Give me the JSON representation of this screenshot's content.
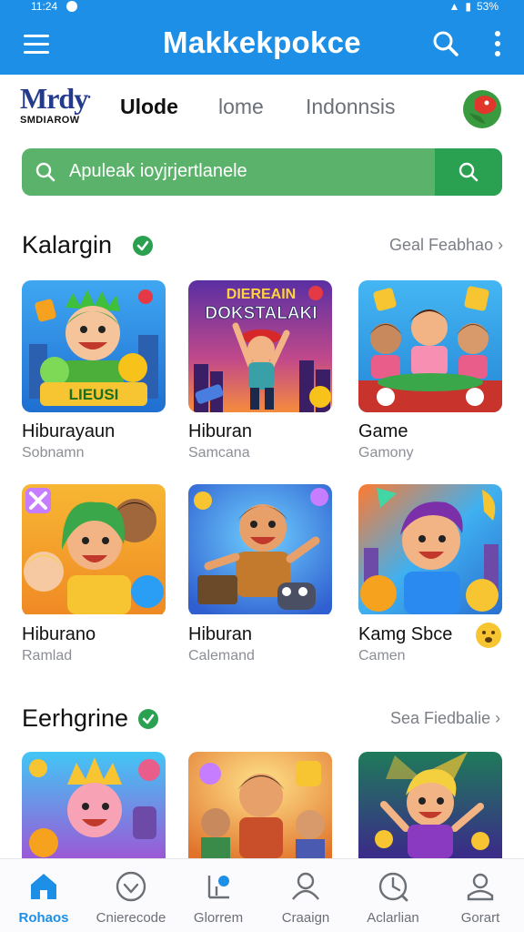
{
  "status_bar": {
    "time": "11:24",
    "battery": "53%"
  },
  "app_bar": {
    "title": "Makkekpokce"
  },
  "brand": {
    "logo_text": "Mrdy",
    "logo_sub": "SMDIAROW"
  },
  "tabs": [
    {
      "label": "Ulode",
      "active": true
    },
    {
      "label": "lome",
      "active": false
    },
    {
      "label": "Indonnsis",
      "active": false
    }
  ],
  "search": {
    "placeholder": "Apuleak ioyjrjertlanele"
  },
  "sections": [
    {
      "title": "Kalargin",
      "see_all": "Geal Feabhao",
      "items": [
        {
          "name": "Hiburayaun",
          "sub": "Sobnamn"
        },
        {
          "name": "Hiburan",
          "sub": "Samcana"
        },
        {
          "name": "Game",
          "sub": "Gamony"
        },
        {
          "name": "Hiburano",
          "sub": "Ramlad"
        },
        {
          "name": "Hiburan",
          "sub": "Calemand"
        },
        {
          "name": "Kamg Sbce",
          "sub": "Camen"
        }
      ]
    },
    {
      "title": "Eerhgrine",
      "see_all": "Sea Fiedbalie",
      "items": []
    }
  ],
  "card_art": {
    "poster_title_1": "DIEREAIN",
    "poster_title_2": "DOKSTALAKI",
    "badge_text": "LIEUSI"
  },
  "bottom_nav": [
    {
      "label": "Rohaos",
      "icon": "home-icon",
      "active": true
    },
    {
      "label": "Cnierecode",
      "icon": "heart-icon",
      "active": false
    },
    {
      "label": "Glorrem",
      "icon": "chart-icon",
      "active": false
    },
    {
      "label": "Craaign",
      "icon": "person-icon",
      "active": false
    },
    {
      "label": "Aclarlian",
      "icon": "clock-icon",
      "active": false
    },
    {
      "label": "Gorart",
      "icon": "profile-icon",
      "active": false
    }
  ],
  "colors": {
    "primary": "#1e8fe6",
    "search_green": "#5bb36b",
    "search_btn": "#2aa051",
    "check_green": "#2aa051"
  }
}
